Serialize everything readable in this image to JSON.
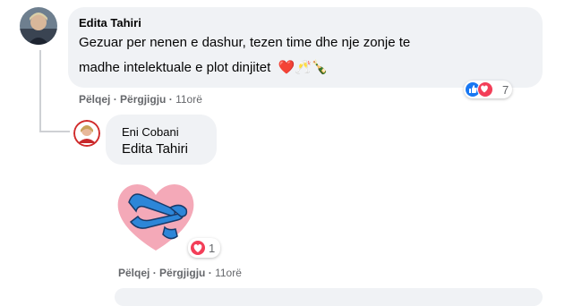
{
  "comment1": {
    "author": "Edita Tahiri",
    "text_line1": "Gezuar per nenen e dashur, tezen time dhe nje zonje te",
    "text_line2": "madhe intelektuale e plot dinjitet",
    "emojis": "❤️🥂🍾",
    "reaction_count": "7",
    "actions": {
      "like": "Pëlqej",
      "reply": "Përgjigju",
      "time": "11orë"
    }
  },
  "reply1": {
    "author": "Eni Cobani",
    "mention": "Edita Tahiri",
    "sticker_reaction_count": "1",
    "actions": {
      "like": "Pëlqej",
      "reply": "Përgjigju",
      "time": "11orë"
    }
  },
  "colors": {
    "like_blue": "#1877f2",
    "love_red": "#f33e58",
    "meta_gray": "#65676b",
    "bubble_bg": "#f0f2f5",
    "sticker_pink": "#f4a9b8",
    "sticker_blue": "#2d86d8"
  },
  "icons": [
    "like-reaction-icon",
    "love-reaction-icon",
    "heart-hug-sticker"
  ]
}
